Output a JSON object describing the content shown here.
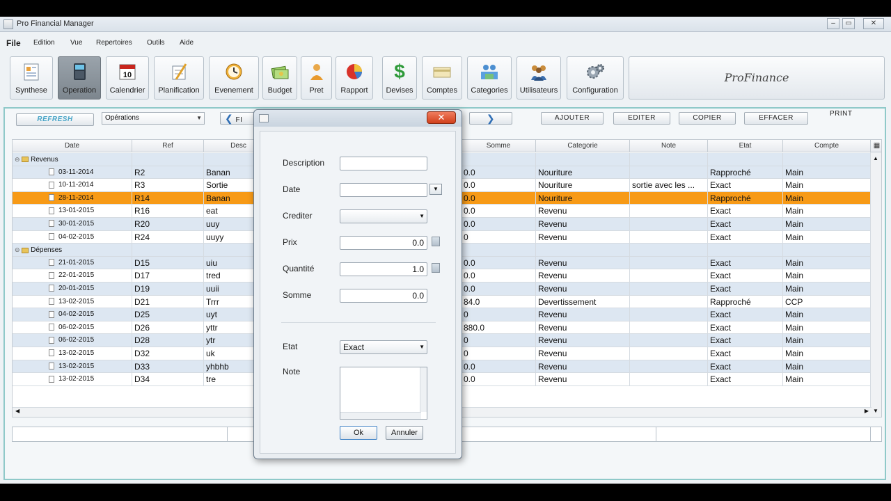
{
  "app_title": "Pro Financial Manager",
  "menu": [
    "File",
    "Edition",
    "Vue",
    "Repertoires",
    "Outils",
    "Aide"
  ],
  "toolbar": [
    {
      "label": "Synthese",
      "icon": "report-icon"
    },
    {
      "label": "Operation",
      "icon": "calculator-icon"
    },
    {
      "label": "Calendrier",
      "icon": "calendar-icon",
      "badge": "10"
    },
    {
      "label": "Planification",
      "icon": "planning-icon"
    },
    {
      "label": "Evenement",
      "icon": "clock-icon"
    },
    {
      "label": "Budget",
      "icon": "money-icon"
    },
    {
      "label": "Pret",
      "icon": "person-icon"
    },
    {
      "label": "Rapport",
      "icon": "pie-chart-icon"
    },
    {
      "label": "Devises",
      "icon": "dollar-icon"
    },
    {
      "label": "Comptes",
      "icon": "card-icon"
    },
    {
      "label": "Categories",
      "icon": "categories-icon"
    },
    {
      "label": "Utilisateurs",
      "icon": "users-icon"
    },
    {
      "label": "Configuration",
      "icon": "gears-icon"
    }
  ],
  "brand": "ProFinance",
  "controls": {
    "refresh": "REFRESH",
    "view_select": "Opérations",
    "filter_btn": "FI",
    "ajouter": "AJOUTER",
    "editer": "EDITER",
    "copier": "COPIER",
    "effacer": "EFFACER",
    "print": "PRINT"
  },
  "table": {
    "headers": [
      "Date",
      "Ref",
      "Desc",
      "Somme",
      "Categorie",
      "Note",
      "Etat",
      "Compte"
    ],
    "groups": [
      "Revenus",
      "Dépenses"
    ],
    "rows": [
      {
        "date": "03-11-2014",
        "ref": "R2",
        "desc": "Banan",
        "somme": "0.0",
        "cat": "Nouriture",
        "note": "",
        "etat": "Rapproché",
        "compte": "Main"
      },
      {
        "date": "10-11-2014",
        "ref": "R3",
        "desc": "Sortie",
        "somme": "0.0",
        "cat": "Nouriture",
        "note": "sortie avec les ...",
        "etat": "Exact",
        "compte": "Main"
      },
      {
        "date": "28-11-2014",
        "ref": "R14",
        "desc": "Banan",
        "somme": "0.0",
        "cat": "Nouriture",
        "note": "",
        "etat": "Rapproché",
        "compte": "Main"
      },
      {
        "date": "13-01-2015",
        "ref": "R16",
        "desc": "eat",
        "somme": "0.0",
        "cat": "Revenu",
        "note": "",
        "etat": "Exact",
        "compte": "Main"
      },
      {
        "date": "30-01-2015",
        "ref": "R20",
        "desc": "uuy",
        "somme": "0.0",
        "cat": "Revenu",
        "note": "",
        "etat": "Exact",
        "compte": "Main"
      },
      {
        "date": "04-02-2015",
        "ref": "R24",
        "desc": "uuyy",
        "somme": "0",
        "cat": "Revenu",
        "note": "",
        "etat": "Exact",
        "compte": "Main"
      },
      {
        "date": "21-01-2015",
        "ref": "D15",
        "desc": "uiu",
        "somme": "0.0",
        "cat": "Revenu",
        "note": "",
        "etat": "Exact",
        "compte": "Main"
      },
      {
        "date": "22-01-2015",
        "ref": "D17",
        "desc": "tred",
        "somme": "0.0",
        "cat": "Revenu",
        "note": "",
        "etat": "Exact",
        "compte": "Main"
      },
      {
        "date": "20-01-2015",
        "ref": "D19",
        "desc": "uuii",
        "somme": "0.0",
        "cat": "Revenu",
        "note": "",
        "etat": "Exact",
        "compte": "Main"
      },
      {
        "date": "13-02-2015",
        "ref": "D21",
        "desc": "Trrr",
        "somme": "84.0",
        "cat": "Devertissement",
        "note": "",
        "etat": "Rapproché",
        "compte": "CCP"
      },
      {
        "date": "04-02-2015",
        "ref": "D25",
        "desc": "uyt",
        "somme": "0",
        "cat": "Revenu",
        "note": "",
        "etat": "Exact",
        "compte": "Main"
      },
      {
        "date": "06-02-2015",
        "ref": "D26",
        "desc": "yttr",
        "somme": "880.0",
        "cat": "Revenu",
        "note": "",
        "etat": "Exact",
        "compte": "Main"
      },
      {
        "date": "06-02-2015",
        "ref": "D28",
        "desc": "ytr",
        "somme": "0",
        "cat": "Revenu",
        "note": "",
        "etat": "Exact",
        "compte": "Main"
      },
      {
        "date": "13-02-2015",
        "ref": "D32",
        "desc": "uk",
        "somme": "0",
        "cat": "Revenu",
        "note": "",
        "etat": "Exact",
        "compte": "Main"
      },
      {
        "date": "13-02-2015",
        "ref": "D33",
        "desc": "yhbhb",
        "somme": "0.0",
        "cat": "Revenu",
        "note": "",
        "etat": "Exact",
        "compte": "Main"
      },
      {
        "date": "13-02-2015",
        "ref": "D34",
        "desc": "tre",
        "somme": "0.0",
        "cat": "Revenu",
        "note": "",
        "etat": "Exact",
        "compte": "Main"
      }
    ]
  },
  "dialog": {
    "labels": {
      "description": "Description",
      "date": "Date",
      "crediter": "Crediter",
      "prix": "Prix",
      "quantite": "Quantité",
      "somme": "Somme",
      "etat": "Etat",
      "note": "Note"
    },
    "values": {
      "description": "",
      "date": "",
      "crediter": "",
      "prix": "0.0",
      "quantite": "1.0",
      "somme": "0.0",
      "etat": "Exact"
    },
    "ok": "Ok",
    "annuler": "Annuler",
    "close": "✕"
  },
  "colors": {
    "selected_row": "#f79a17",
    "alt_row": "#dde7f2",
    "panel_border": "#8fc9c9"
  }
}
